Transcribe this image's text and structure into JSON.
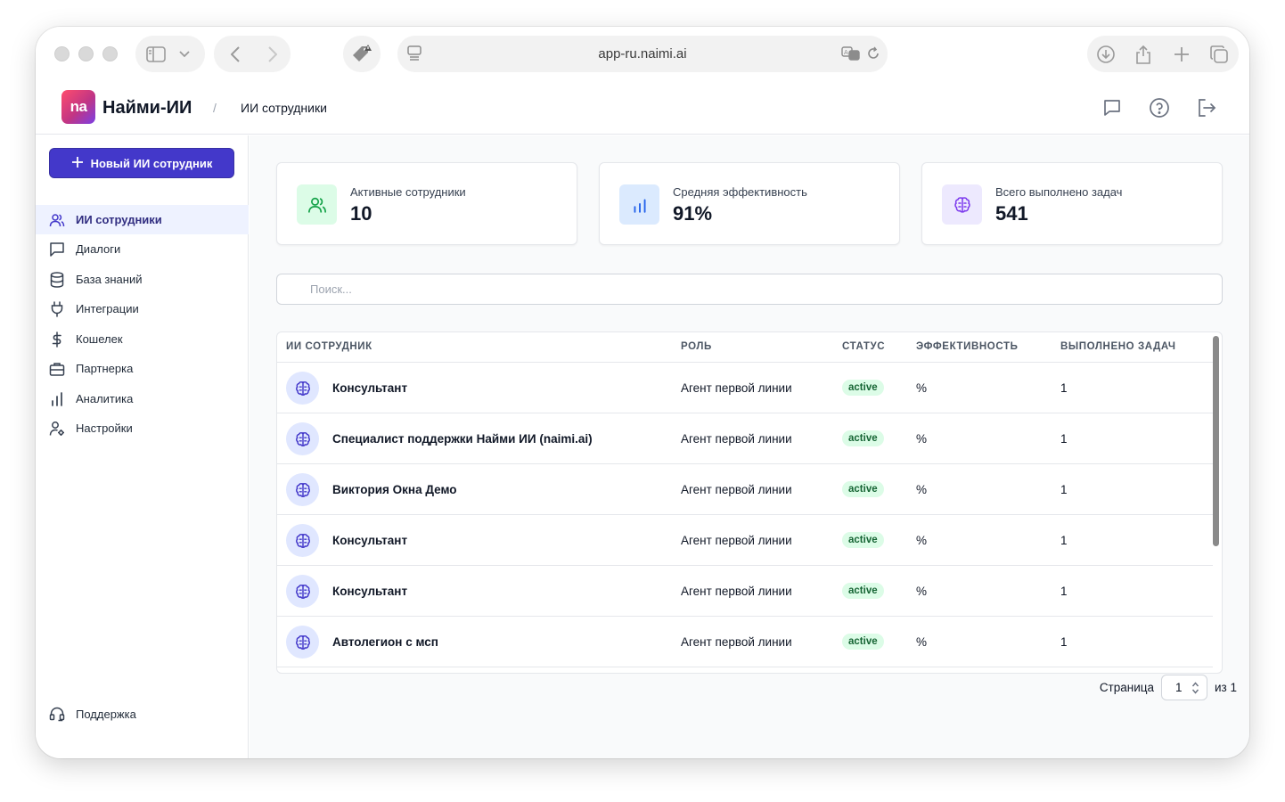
{
  "browser": {
    "url": "app-ru.naimi.ai"
  },
  "app": {
    "logo_text": "nа",
    "brand": "Найми-ИИ",
    "breadcrumb_sep": "/",
    "breadcrumb": "ИИ сотрудники"
  },
  "sidebar": {
    "new_button": "Новый ИИ сотрудник",
    "items": [
      {
        "label": "ИИ сотрудники",
        "icon": "users-icon",
        "active": true
      },
      {
        "label": "Диалоги",
        "icon": "chat-icon"
      },
      {
        "label": "База знаний",
        "icon": "database-icon"
      },
      {
        "label": "Интеграции",
        "icon": "plug-icon"
      },
      {
        "label": "Кошелек",
        "icon": "dollar-icon"
      },
      {
        "label": "Партнерка",
        "icon": "briefcase-icon"
      },
      {
        "label": "Аналитика",
        "icon": "bar-chart-icon"
      },
      {
        "label": "Настройки",
        "icon": "user-settings-icon"
      }
    ],
    "support": "Поддержка"
  },
  "stats": [
    {
      "label": "Активные сотрудники",
      "value": "10",
      "icon": "users-icon",
      "color": "#16a34a",
      "bg": "#dcfce7"
    },
    {
      "label": "Средняя эффективность",
      "value": "91%",
      "icon": "bar-chart-icon",
      "color": "#2563eb",
      "bg": "#dbeafe"
    },
    {
      "label": "Всего выполнено задач",
      "value": "541",
      "icon": "brain-icon",
      "color": "#7c3aed",
      "bg": "#ede9fe"
    }
  ],
  "search": {
    "placeholder": "Поиск...",
    "value": ""
  },
  "table": {
    "columns": [
      "ИИ СОТРУДНИК",
      "РОЛЬ",
      "СТАТУС",
      "ЭФФЕКТИВНОСТЬ",
      "ВЫПОЛНЕНО ЗАДАЧ"
    ],
    "rows": [
      {
        "name": "Консультант",
        "role": "Агент первой линии",
        "status": "active",
        "efficiency": "%",
        "tasks": "1"
      },
      {
        "name": "Специалист поддержки Найми ИИ (naimi.ai)",
        "role": "Агент первой линии",
        "status": "active",
        "efficiency": "%",
        "tasks": "1"
      },
      {
        "name": "Виктория Окна Демо",
        "role": "Агент первой линии",
        "status": "active",
        "efficiency": "%",
        "tasks": "1"
      },
      {
        "name": "Консультант",
        "role": "Агент первой линии",
        "status": "active",
        "efficiency": "%",
        "tasks": "1"
      },
      {
        "name": "Консультант",
        "role": "Агент первой линии",
        "status": "active",
        "efficiency": "%",
        "tasks": "1"
      },
      {
        "name": "Автолегион с мсп",
        "role": "Агент первой линии",
        "status": "active",
        "efficiency": "%",
        "tasks": "1"
      }
    ]
  },
  "pagination": {
    "label": "Страница",
    "current": "1",
    "of_label": "из 1"
  }
}
